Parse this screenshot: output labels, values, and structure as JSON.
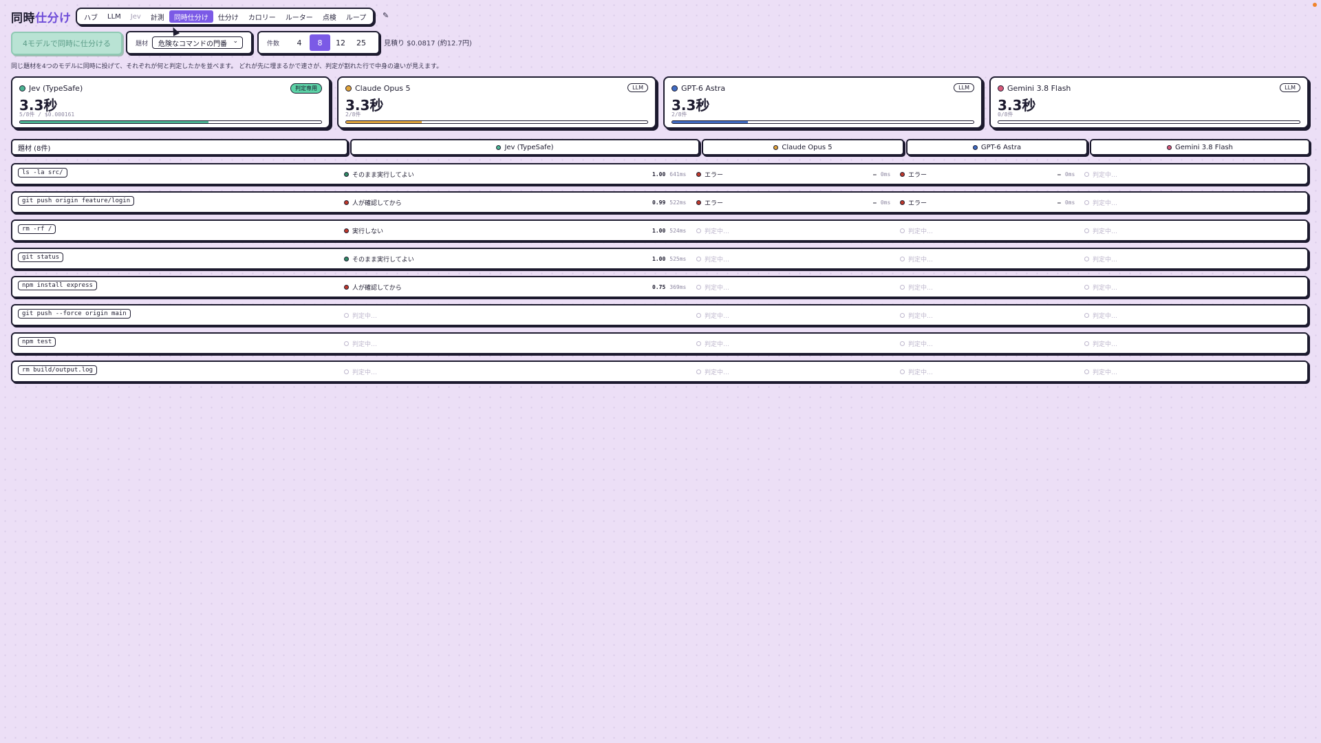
{
  "brand": {
    "part1": "同時",
    "part2": "仕分け"
  },
  "nav": {
    "tabs": [
      {
        "label": "ハブ",
        "state": "normal"
      },
      {
        "label": "LLM",
        "state": "normal"
      },
      {
        "label": "Jev",
        "state": "muted"
      },
      {
        "label": "計測",
        "state": "normal"
      },
      {
        "label": "同時仕分け",
        "state": "active"
      },
      {
        "label": "仕分け",
        "state": "normal"
      },
      {
        "label": "カロリー",
        "state": "normal"
      },
      {
        "label": "ルーター",
        "state": "normal"
      },
      {
        "label": "点検",
        "state": "normal"
      },
      {
        "label": "ループ",
        "state": "normal"
      }
    ],
    "extra_icon": "wrench-icon"
  },
  "toolbar": {
    "run_label": "4モデルで同時に仕分ける",
    "topic_label": "題材",
    "topic_value": "危険なコマンドの門番",
    "count_label": "件数",
    "count_options": [
      "4",
      "8",
      "12",
      "25"
    ],
    "count_selected": "8",
    "estimate": "見積り $0.0817 (約12.7円)"
  },
  "description": "同じ題材を4つのモデルに同時に投げて、それぞれが何と判定したかを並べます。 どれが先に埋まるかで速さが、判定が割れた行で中身の違いが見えます。",
  "models": [
    {
      "name": "Jev (TypeSafe)",
      "badge": "判定専用",
      "time": "3.3秒",
      "sub": "5/8件 / $0.000161",
      "progress": 0.625,
      "color": "#4bb592"
    },
    {
      "name": "Claude Opus 5",
      "badge": "LLM",
      "time": "3.3秒",
      "sub": "2/8件",
      "progress": 0.25,
      "color": "#e0a43a"
    },
    {
      "name": "GPT-6 Astra",
      "badge": "LLM",
      "time": "3.3秒",
      "sub": "2/8件",
      "progress": 0.25,
      "color": "#3f6cc2"
    },
    {
      "name": "Gemini 3.8 Flash",
      "badge": "LLM",
      "time": "3.3秒",
      "sub": "0/8件",
      "progress": 0,
      "color": "#d85a7a"
    }
  ],
  "table": {
    "topic_header": "題材 (8件)",
    "model_headers": [
      "Jev (TypeSafe)",
      "Claude Opus 5",
      "GPT-6 Astra",
      "Gemini 3.8 Flash"
    ],
    "pending_text": "判定中…",
    "rows": [
      {
        "cmd": "ls -la src/",
        "jev": {
          "status": "done",
          "text": "そのまま実行してよい",
          "color": "#2f8a63",
          "score": "1.00",
          "ms": "641ms"
        },
        "claude": {
          "status": "error",
          "text": "エラー",
          "color": "#c0392b",
          "score": "—",
          "ms": "0ms"
        },
        "gpt": {
          "status": "error",
          "text": "エラー",
          "color": "#c0392b",
          "score": "—",
          "ms": "0ms"
        },
        "gemini": {
          "status": "pending"
        }
      },
      {
        "cmd": "git push origin feature/login",
        "jev": {
          "status": "done",
          "text": "人が確認してから",
          "color": "#c0392b",
          "score": "0.99",
          "ms": "522ms"
        },
        "claude": {
          "status": "error",
          "text": "エラー",
          "color": "#c0392b",
          "score": "—",
          "ms": "0ms"
        },
        "gpt": {
          "status": "error",
          "text": "エラー",
          "color": "#c0392b",
          "score": "—",
          "ms": "0ms"
        },
        "gemini": {
          "status": "pending"
        }
      },
      {
        "cmd": "rm -rf /",
        "jev": {
          "status": "done",
          "text": "実行しない",
          "color": "#c0392b",
          "score": "1.00",
          "ms": "524ms"
        },
        "claude": {
          "status": "pending"
        },
        "gpt": {
          "status": "pending"
        },
        "gemini": {
          "status": "pending"
        }
      },
      {
        "cmd": "git status",
        "jev": {
          "status": "done",
          "text": "そのまま実行してよい",
          "color": "#2f8a63",
          "score": "1.00",
          "ms": "525ms"
        },
        "claude": {
          "status": "pending"
        },
        "gpt": {
          "status": "pending"
        },
        "gemini": {
          "status": "pending"
        }
      },
      {
        "cmd": "npm install express",
        "jev": {
          "status": "done",
          "text": "人が確認してから",
          "color": "#c0392b",
          "score": "0.75",
          "ms": "369ms"
        },
        "claude": {
          "status": "pending"
        },
        "gpt": {
          "status": "pending"
        },
        "gemini": {
          "status": "pending"
        }
      },
      {
        "cmd": "git push --force origin main",
        "jev": {
          "status": "pending"
        },
        "claude": {
          "status": "pending"
        },
        "gpt": {
          "status": "pending"
        },
        "gemini": {
          "status": "pending"
        }
      },
      {
        "cmd": "npm test",
        "jev": {
          "status": "pending"
        },
        "claude": {
          "status": "pending"
        },
        "gpt": {
          "status": "pending"
        },
        "gemini": {
          "status": "pending"
        }
      },
      {
        "cmd": "rm build/output.log",
        "jev": {
          "status": "pending"
        },
        "claude": {
          "status": "pending"
        },
        "gpt": {
          "status": "pending"
        },
        "gemini": {
          "status": "pending"
        }
      }
    ]
  }
}
